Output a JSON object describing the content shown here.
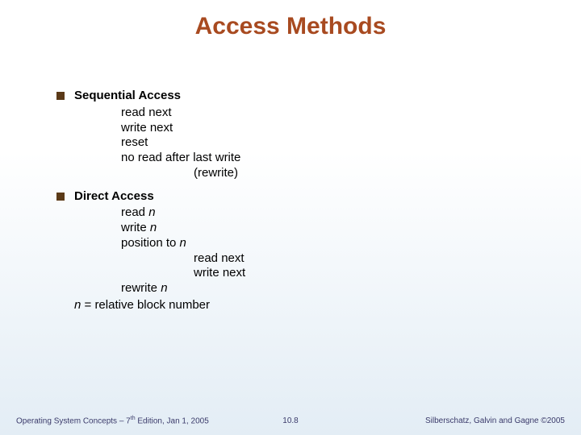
{
  "title": "Access Methods",
  "sections": [
    {
      "heading": "Sequential Access",
      "lines": [
        {
          "text": "read next",
          "indent": 1
        },
        {
          "text": "write next",
          "indent": 1
        },
        {
          "text": "reset",
          "indent": 1
        },
        {
          "text": "no read after last write",
          "indent": 1
        },
        {
          "text": "(rewrite)",
          "indent": 2
        }
      ]
    },
    {
      "heading": "Direct Access",
      "lines": [
        {
          "text": "read n",
          "indent": 1,
          "italicAfter": "read ",
          "italicText": "n"
        },
        {
          "text": "write n",
          "indent": 1,
          "italicAfter": "write ",
          "italicText": "n"
        },
        {
          "text": "position to n",
          "indent": 1,
          "italicAfter": "position to ",
          "italicText": "n"
        },
        {
          "text": "read next",
          "indent": 2
        },
        {
          "text": "write next",
          "indent": 2
        },
        {
          "text": "rewrite n",
          "indent": 1,
          "italicAfter": "rewrite ",
          "italicText": "n"
        }
      ],
      "note_prefix_italic": "n",
      "note_rest": " = relative block number"
    }
  ],
  "footer": {
    "left_a": "Operating System Concepts – 7",
    "left_sup": "th",
    "left_b": " Edition, Jan 1, 2005",
    "center": "10.8",
    "right": "Silberschatz, Galvin and Gagne ©2005"
  }
}
